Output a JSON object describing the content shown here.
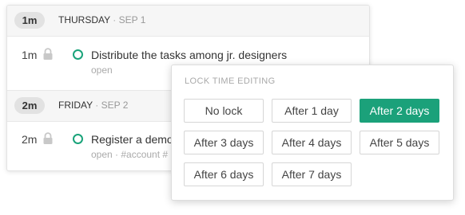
{
  "groups": [
    {
      "duration_badge": "1m",
      "day": "THURSDAY",
      "separator": "·",
      "date": "SEP 1",
      "task": {
        "duration": "1m",
        "title": "Distribute the tasks among jr. designers",
        "meta": "open"
      }
    },
    {
      "duration_badge": "2m",
      "day": "FRIDAY",
      "separator": "·",
      "date": "SEP 2",
      "task": {
        "duration": "2m",
        "title": "Register a demo",
        "meta": "open · #account #"
      }
    }
  ],
  "lock_popover": {
    "title": "LOCK TIME EDITING",
    "options": [
      "No lock",
      "After 1 day",
      "After 2 days",
      "After 3 days",
      "After 4 days",
      "After 5 days",
      "After 6 days",
      "After 7 days"
    ],
    "selected": "After 2 days"
  },
  "colors": {
    "accent": "#1ba17a",
    "status_open": "#1aa37a",
    "header_bg": "#f6f6f6",
    "badge_bg": "#e2e2e2"
  },
  "icons": {
    "lock": "lock-icon",
    "status": "open-circle-icon"
  }
}
